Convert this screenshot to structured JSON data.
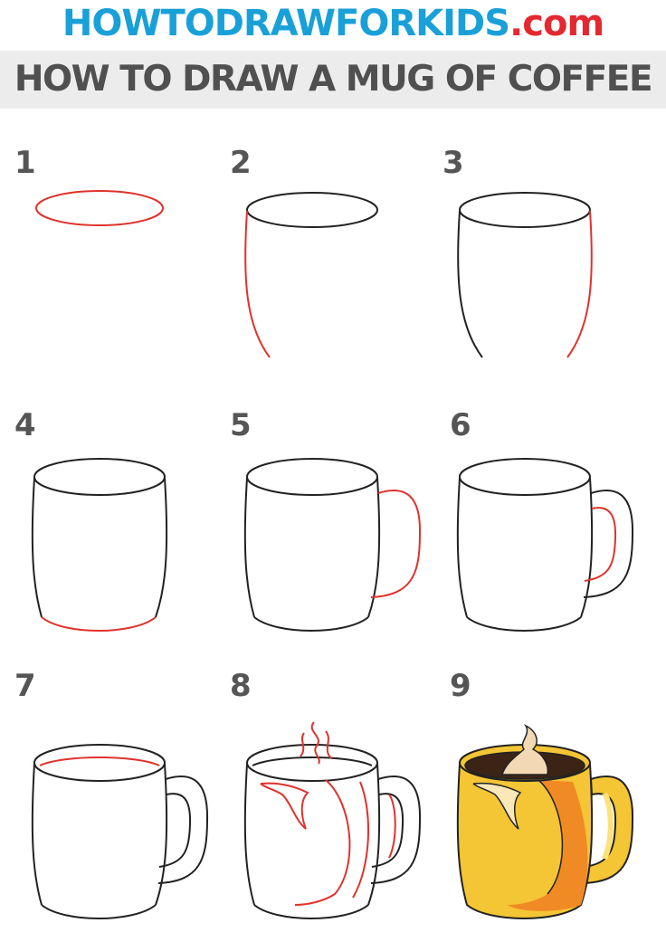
{
  "header": {
    "site_name": "HOWTODRAWFORKIDS",
    "site_domain": ".com",
    "title": "How to Draw a Mug of Coffee"
  },
  "steps": [
    {
      "number": "1"
    },
    {
      "number": "2"
    },
    {
      "number": "3"
    },
    {
      "number": "4"
    },
    {
      "number": "5"
    },
    {
      "number": "6"
    },
    {
      "number": "7"
    },
    {
      "number": "8"
    },
    {
      "number": "9"
    }
  ],
  "colors": {
    "site_name": "#1aa0d8",
    "site_domain": "#e4282f",
    "title_text": "#505050",
    "title_band": "#ececec",
    "outline": "#222222",
    "new_line": "#e0322c",
    "mug_fill": "#f4c534",
    "coffee": "#3b2416",
    "foam": "#f3d8b4"
  }
}
